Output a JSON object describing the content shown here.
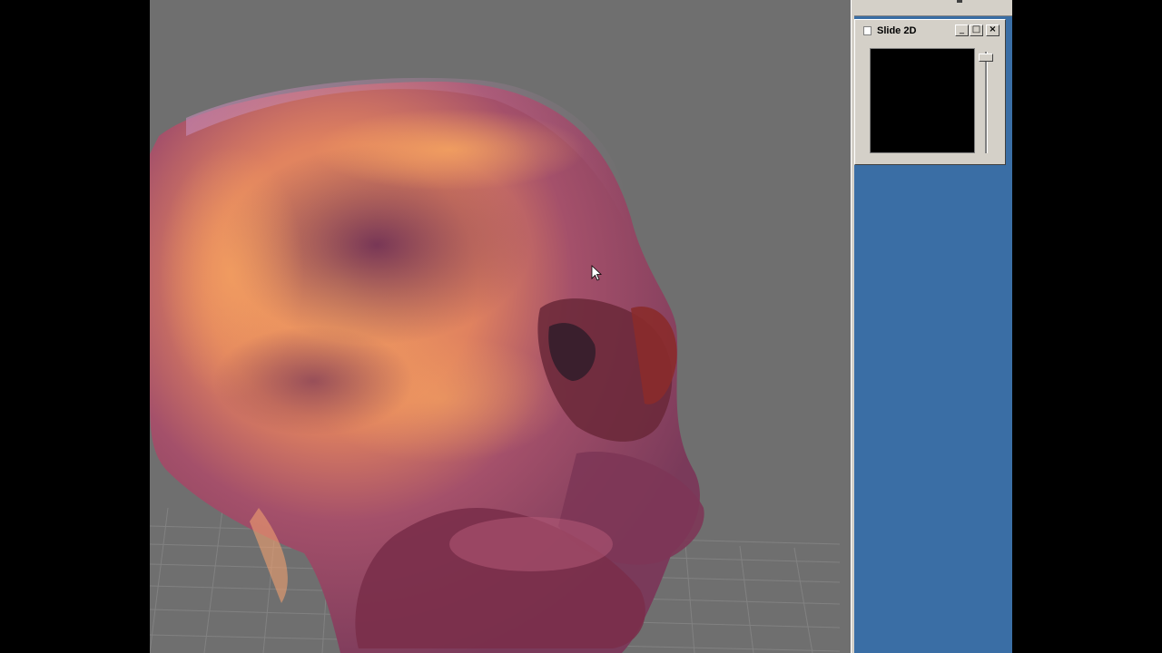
{
  "slide_window": {
    "title": "Slide 2D",
    "minimize_glyph": "_",
    "maximize_glyph": "□",
    "close_glyph": "×",
    "slider_position": 0.05
  },
  "viewport": {
    "background_color": "#6f6f6f",
    "model": "skull-volume-render"
  },
  "side_panel": {
    "background_color": "#3a6ea5"
  },
  "cursor": {
    "icon": "arrow-cursor-icon"
  }
}
